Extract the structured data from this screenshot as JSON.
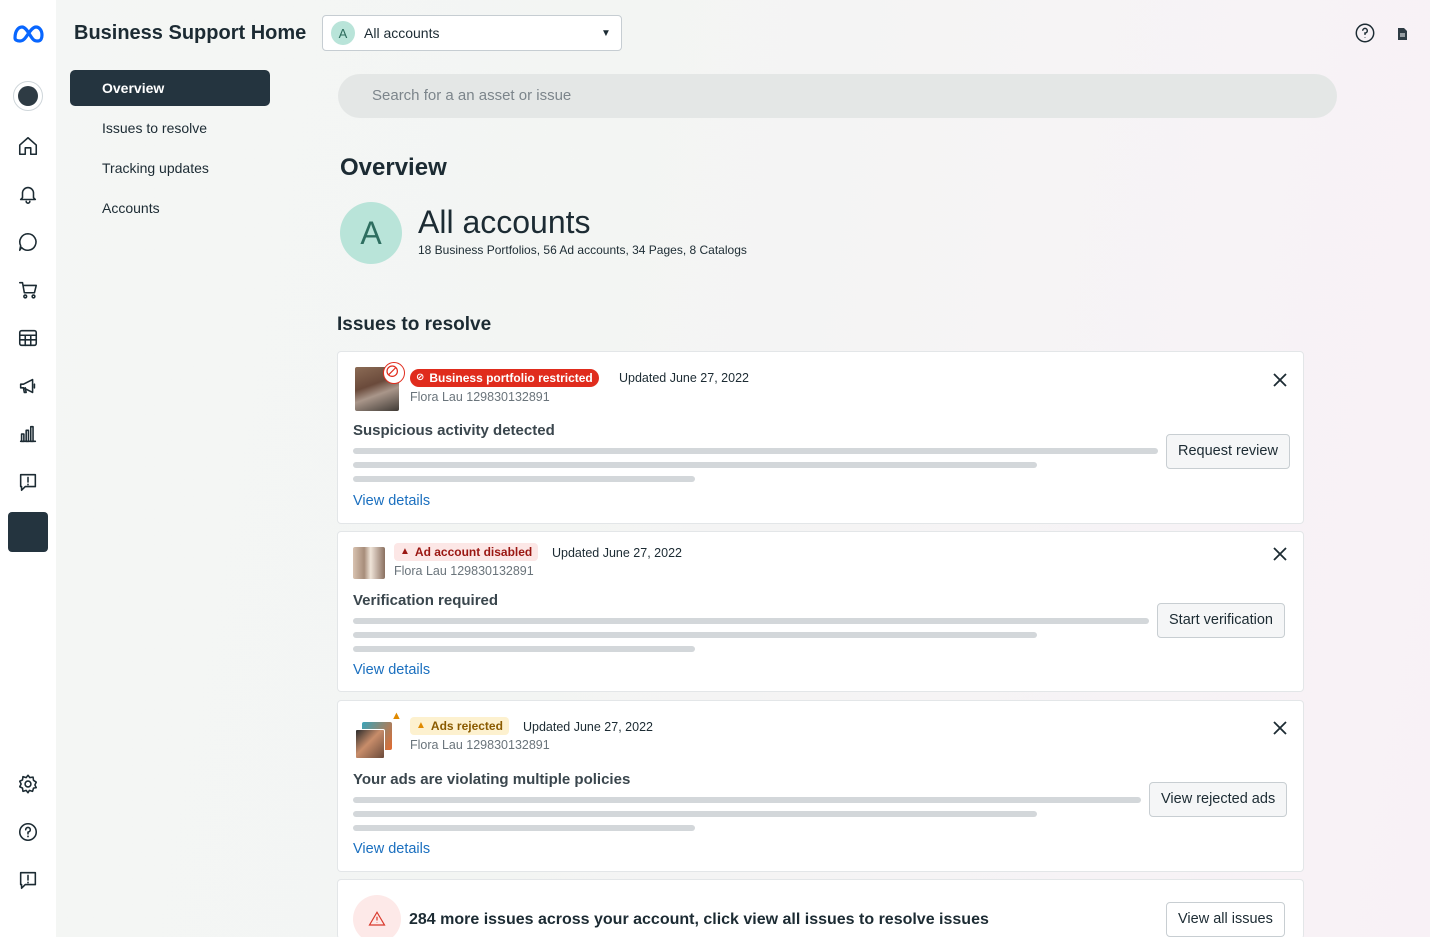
{
  "app": {
    "title": "Business Support Home"
  },
  "account_select": {
    "avatar_letter": "A",
    "value": "All accounts"
  },
  "subnav": {
    "items": [
      {
        "label": "Overview",
        "active": true
      },
      {
        "label": "Issues to resolve"
      },
      {
        "label": "Tracking updates"
      },
      {
        "label": "Accounts"
      }
    ]
  },
  "search": {
    "placeholder": "Search for a an asset or issue"
  },
  "overview": {
    "heading": "Overview",
    "avatar_letter": "A",
    "title": "All accounts",
    "summary": "18 Business Portfolios, 56 Ad accounts, 34 Pages, 8 Catalogs"
  },
  "issues": {
    "heading": "Issues to resolve",
    "cards": [
      {
        "badge": "Business portfolio restricted",
        "updated": "Updated June 27, 2022",
        "owner": "Flora Lau 129830132891",
        "title": "Suspicious activity detected",
        "action": "Request review",
        "link": "View details"
      },
      {
        "badge": "Ad account disabled",
        "updated": "Updated June 27, 2022",
        "owner": "Flora Lau 129830132891",
        "title": "Verification required",
        "action": "Start verification",
        "link": "View details"
      },
      {
        "badge": "Ads rejected",
        "updated": "Updated June 27, 2022",
        "owner": "Flora Lau 129830132891",
        "title": "Your ads are violating multiple policies",
        "action": "View rejected ads",
        "link": "View details"
      }
    ],
    "more": {
      "text": "284 more issues across your account, click view all issues to resolve issues",
      "action": "View all issues"
    }
  },
  "colors": {
    "brand_dark": "#24343f",
    "link": "#1a6fbf",
    "badge_red": "#e02c1d",
    "avatar_green": "#b9e4d9"
  }
}
